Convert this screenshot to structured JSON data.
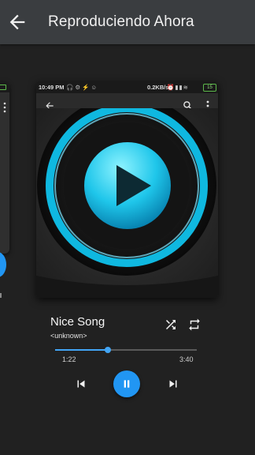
{
  "app_bar": {
    "title": "Reproduciendo Ahora",
    "back_icon": "arrow-left-icon"
  },
  "embedded_screenshot": {
    "status_bar": {
      "time": "10:49 PM",
      "speed": "0.2KB/s",
      "battery": "15",
      "icons": [
        "headphones-icon",
        "settings-icon",
        "usb-icon",
        "android-icon",
        "alarm-icon",
        "signal-icon",
        "signal-icon",
        "wifi-icon"
      ]
    },
    "toolbar_icons": [
      "arrow-left-icon",
      "search-icon",
      "more-vert-icon"
    ],
    "artwork": {
      "icon": "play-icon",
      "accent": "#00c8f0"
    }
  },
  "now_playing": {
    "title": "Nice Song",
    "artist": "<unknown>"
  },
  "progress": {
    "elapsed": "1:22",
    "total": "3:40",
    "fraction": 0.373
  },
  "controls": {
    "shuffle_icon": "shuffle-icon",
    "repeat_icon": "repeat-icon",
    "prev_icon": "skip-previous-icon",
    "play_pause_icon": "pause-icon",
    "next_icon": "skip-next-icon"
  },
  "colors": {
    "accent": "#2196f3",
    "app_bar": "#3a3d40",
    "background": "#212121"
  }
}
